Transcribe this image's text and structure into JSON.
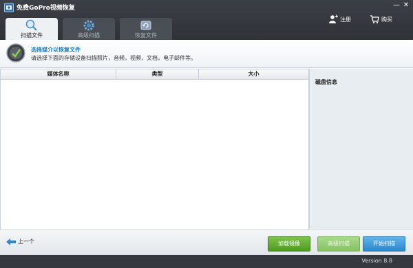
{
  "app": {
    "title": "免费GoPro视频恢复"
  },
  "window": {
    "minimize": "—",
    "close": "✕"
  },
  "top_actions": {
    "register": "注册",
    "buy": "购买"
  },
  "tabs": [
    {
      "label": "扫描文件",
      "active": true
    },
    {
      "label": "高级扫描",
      "active": false
    },
    {
      "label": "恢复文件",
      "active": false
    }
  ],
  "info": {
    "title": "选择媒介以恢复文件",
    "description": "请选择下面的存储设备扫描照片，音频，视频，文档，电子邮件等。"
  },
  "table": {
    "columns": [
      "媒体名称",
      "类型",
      "大小"
    ],
    "rows": []
  },
  "disk_panel": {
    "title": "磁盘信息"
  },
  "bottom": {
    "back": "上一个",
    "load_image": "加载镜像",
    "advanced_scan": "高级扫描",
    "start_scan": "开始扫描"
  },
  "footer": {
    "version": "Version 8.8"
  },
  "colors": {
    "accent": "#1d7fc0",
    "green": "#5aa82b",
    "blue": "#2f86c9",
    "header": "#35393f"
  }
}
